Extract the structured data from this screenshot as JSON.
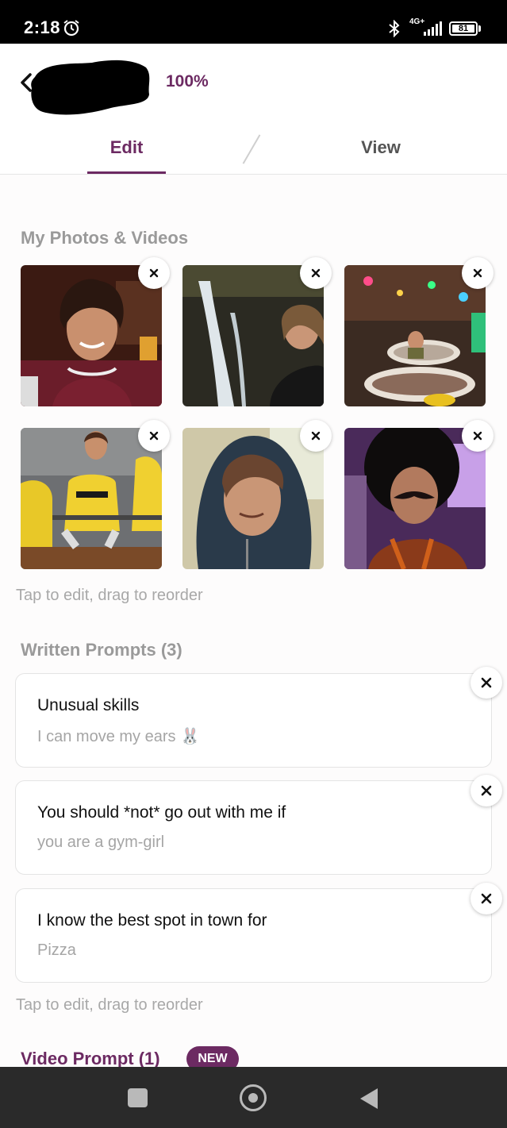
{
  "status_bar": {
    "time": "2:18",
    "network": "4G+",
    "battery": "81"
  },
  "header": {
    "completion": "100%"
  },
  "tabs": [
    {
      "label": "Edit"
    },
    {
      "label": "View"
    }
  ],
  "photos_section": {
    "title": "My Photos & Videos",
    "hint": "Tap to edit, drag to reorder"
  },
  "prompts_section": {
    "title": "Written Prompts (3)",
    "hint": "Tap to edit, drag to reorder",
    "prompts": [
      {
        "question": "Unusual skills",
        "answer": "I can move my ears",
        "emoji": "🐰"
      },
      {
        "question": "You should *not* go out with me if",
        "answer": "you are a gym-girl"
      },
      {
        "question": "I know the best spot in town for",
        "answer": "Pizza"
      }
    ]
  },
  "video_section": {
    "title": "Video Prompt (1)",
    "badge": "NEW"
  },
  "colors": {
    "accent": "#6c2a62",
    "muted_text": "#a5a5a5",
    "nav_bar": "#2a2a2a"
  },
  "icons": [
    "alarm-icon",
    "bluetooth-icon",
    "signal-icon",
    "battery-icon",
    "back-arrow-icon",
    "close-icon",
    "recents-icon",
    "home-icon",
    "nav-back-icon"
  ]
}
